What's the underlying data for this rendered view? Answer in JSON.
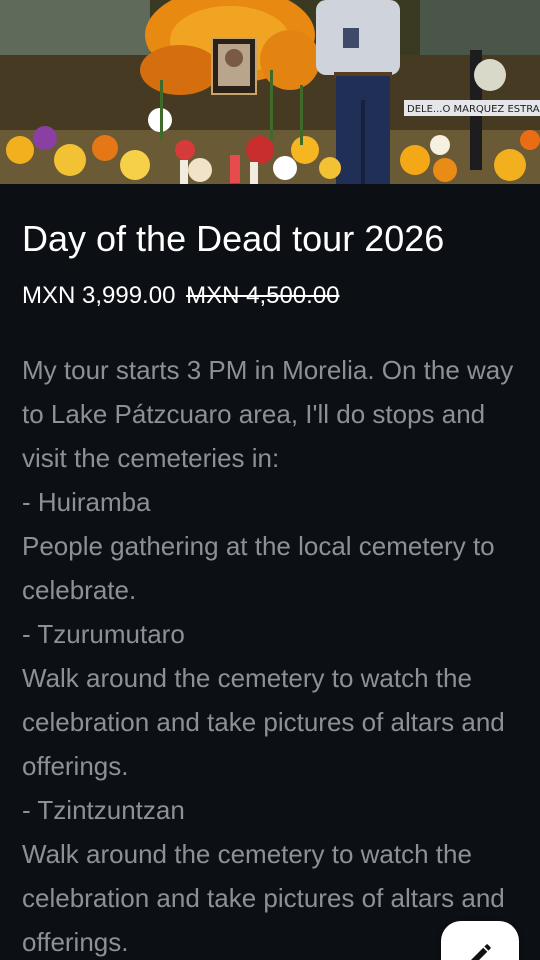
{
  "hero": {
    "image_alt": "Day of the Dead cemetery altar with marigolds",
    "cross_inscription": "DELE...O MARQUEZ ESTRAD"
  },
  "tour": {
    "title": "Day of the Dead tour 2026",
    "price_current": "MXN 3,999.00",
    "price_original": "MXN 4,500.00",
    "description": [
      "My tour starts 3 PM in Morelia. On the way to Lake Pátzcuaro area, I'll do stops and visit the cemeteries in:",
      "- Huiramba",
      "People gathering at the local cemetery to celebrate.",
      "- Tzurumutaro",
      "Walk around the cemetery to watch the celebration and take pictures of altars and offerings.",
      "- Tzintzuntzan",
      "Walk around the cemetery to watch the celebration and take pictures of altars and offerings."
    ]
  },
  "fab": {
    "icon": "pencil-icon"
  },
  "colors": {
    "background": "#0c0f13",
    "title": "#ffffff",
    "description": "#8d9096",
    "fab_background": "#ffffff"
  }
}
